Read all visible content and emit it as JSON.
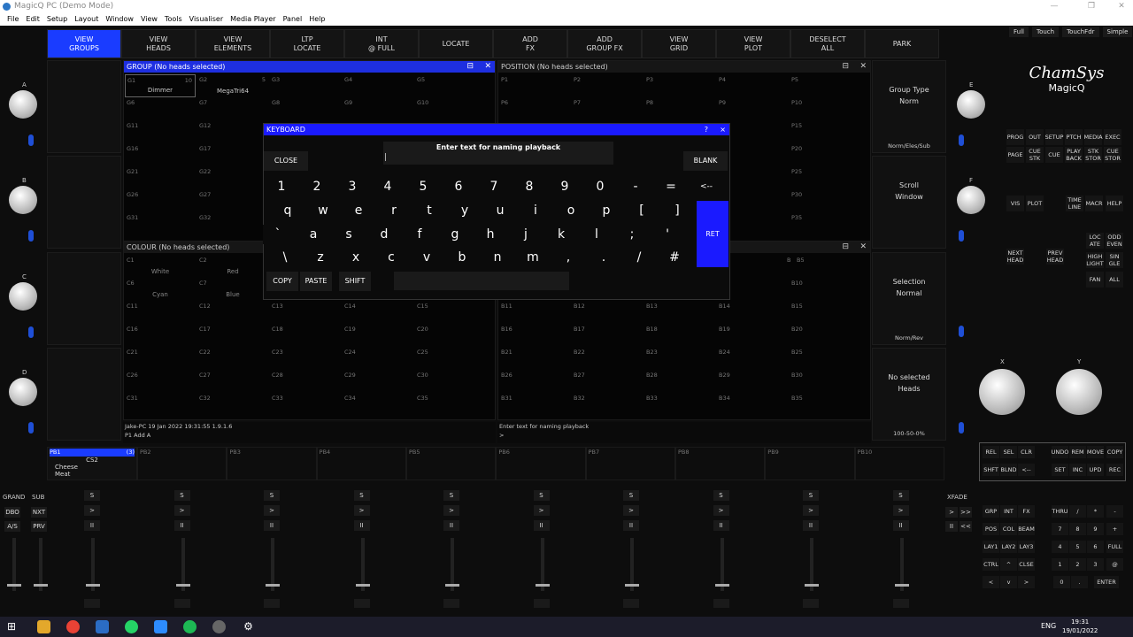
{
  "window": {
    "title": "MagicQ PC (Demo Mode)"
  },
  "menu": [
    "File",
    "Edit",
    "Setup",
    "Layout",
    "Window",
    "View",
    "Tools",
    "Visualiser",
    "Media Player",
    "Panel",
    "Help"
  ],
  "view_buttons": [
    "VIEW\nGROUPS",
    "VIEW\nHEADS",
    "VIEW\nELEMENTS",
    "LTP\nLOCATE",
    "INT\n@ FULL",
    "LOCATE",
    "ADD\nFX",
    "ADD\nGROUP FX",
    "VIEW\nGRID",
    "VIEW\nPLOT",
    "DESELECT\nALL",
    "PARK"
  ],
  "top_right": [
    "Full",
    "Touch",
    "TouchFdr",
    "Simple"
  ],
  "encoders_left": [
    "A",
    "B",
    "C",
    "D"
  ],
  "encoders_right": [
    "E",
    "F"
  ],
  "xy": [
    "X",
    "Y"
  ],
  "group_window": {
    "title": "GROUP (No heads selected)",
    "cells": [
      {
        "id": "G1",
        "num": "10",
        "name": "Dimmer"
      },
      {
        "id": "G2",
        "num": "5",
        "name": "MegaTri64"
      },
      {
        "id": "G3"
      },
      {
        "id": "G4"
      },
      {
        "id": "G5"
      },
      {
        "id": "G6"
      },
      {
        "id": "G7"
      },
      {
        "id": "G8"
      },
      {
        "id": "G9"
      },
      {
        "id": "G10"
      },
      {
        "id": "G11"
      },
      {
        "id": "G12"
      },
      {
        "id": "G16"
      },
      {
        "id": "G17"
      },
      {
        "id": "G21"
      },
      {
        "id": "G22"
      },
      {
        "id": "G26"
      },
      {
        "id": "G27"
      },
      {
        "id": "G31"
      },
      {
        "id": "G32"
      }
    ]
  },
  "position_window": {
    "title": "POSITION (No heads selected)",
    "cells": [
      "P1",
      "P2",
      "P3",
      "P4",
      "P5",
      "P6",
      "P7",
      "P8",
      "P9",
      "P10",
      "P15",
      "P20",
      "P25",
      "P30",
      "P35"
    ]
  },
  "colour_window": {
    "title": "COLOUR (No heads selected)",
    "cells": [
      {
        "id": "C1",
        "name": "White"
      },
      {
        "id": "C2",
        "name": "Red"
      },
      {
        "id": "C6",
        "name": "Cyan"
      },
      {
        "id": "C7",
        "name": "Blue"
      },
      {
        "id": "C11"
      },
      {
        "id": "C12"
      },
      {
        "id": "C13"
      },
      {
        "id": "C14"
      },
      {
        "id": "C15"
      },
      {
        "id": "C16"
      },
      {
        "id": "C17"
      },
      {
        "id": "C18"
      },
      {
        "id": "C19"
      },
      {
        "id": "C20"
      },
      {
        "id": "C21"
      },
      {
        "id": "C22"
      },
      {
        "id": "C23"
      },
      {
        "id": "C24"
      },
      {
        "id": "C25"
      },
      {
        "id": "C26"
      },
      {
        "id": "C27"
      },
      {
        "id": "C28"
      },
      {
        "id": "C29"
      },
      {
        "id": "C30"
      },
      {
        "id": "C31"
      },
      {
        "id": "C32"
      },
      {
        "id": "C33"
      },
      {
        "id": "C34"
      },
      {
        "id": "C35"
      }
    ]
  },
  "beam_window": {
    "cells": [
      "B5",
      "B10",
      "B11",
      "B12",
      "B13",
      "B14",
      "B15",
      "B16",
      "B17",
      "B18",
      "B19",
      "B20",
      "B21",
      "B22",
      "B23",
      "B24",
      "B25",
      "B26",
      "B27",
      "B28",
      "B29",
      "B30",
      "B31",
      "B32",
      "B33",
      "B34",
      "B35"
    ],
    "shut_fast": "Shut fast",
    "b_label": "B"
  },
  "right_column": [
    {
      "title": "Group Type",
      "value": "Norm",
      "foot": "Norm/Eles/Sub"
    },
    {
      "title": "Scroll",
      "value": "Window",
      "foot": ""
    },
    {
      "title": "Selection",
      "value": "Normal",
      "foot": "Norm/Rev"
    },
    {
      "title": "No selected",
      "value": "Heads",
      "foot": "100-50-0%"
    }
  ],
  "status": {
    "left1": "Jake-PC 19 Jan 2022 19:31:55 1.9.1.6",
    "left2": "P1  Add A",
    "right1": "Enter text for naming playback",
    "right2": ">"
  },
  "keyboard": {
    "title": "KEYBOARD",
    "help": "?",
    "close_x": "×",
    "prompt": "Enter text for naming playback",
    "close": "CLOSE",
    "blank": "BLANK",
    "ret": "RET",
    "copy": "COPY",
    "paste": "PASTE",
    "shift": "SHIFT",
    "row1": [
      "1",
      "2",
      "3",
      "4",
      "5",
      "6",
      "7",
      "8",
      "9",
      "0",
      "-",
      "=",
      "<--"
    ],
    "row2": [
      "q",
      "w",
      "e",
      "r",
      "t",
      "y",
      "u",
      "i",
      "o",
      "p",
      "[",
      "]"
    ],
    "row3": [
      "`",
      "a",
      "s",
      "d",
      "f",
      "g",
      "h",
      "j",
      "k",
      "l",
      ";",
      "'"
    ],
    "row4": [
      "\\",
      "z",
      "x",
      "c",
      "v",
      "b",
      "n",
      "m",
      ",",
      ".",
      "/",
      "#"
    ]
  },
  "logo": {
    "brand": "ChamSys",
    "product": "MagicQ"
  },
  "console_keys_right": [
    [
      "PROG",
      "OUT",
      "SETUP",
      "PTCH",
      "MEDIA",
      "EXEC"
    ],
    [
      "PAGE",
      "CUE STK",
      "CUE",
      "PLAY BACK",
      "STK STOR",
      "CUE STOR"
    ]
  ],
  "console_keys_mid": [
    "VIS",
    "PLOT",
    "TIME LINE",
    "MACR",
    "HELP"
  ],
  "console_keys_lower": [
    [
      "LOC ATE",
      "ODD EVEN"
    ],
    [
      "HIGH LIGHT",
      "SIN GLE"
    ],
    [
      "FAN",
      "ALL"
    ]
  ],
  "next_head": "NEXT HEAD",
  "prev_head": "PREV HEAD",
  "edit_keys": [
    [
      "REL",
      "SEL",
      "CLR",
      "UNDO",
      "REM",
      "MOVE",
      "COPY"
    ],
    [
      "SHFT",
      "BLND",
      "<--",
      "SET",
      "INC",
      "UPD",
      "REC"
    ]
  ],
  "playbacks": [
    {
      "id": "PB1",
      "count": "(3)",
      "cue": "CS2",
      "name": "Cheese\nMeat"
    },
    {
      "id": "PB2"
    },
    {
      "id": "PB3"
    },
    {
      "id": "PB4"
    },
    {
      "id": "PB5"
    },
    {
      "id": "PB6"
    },
    {
      "id": "PB7"
    },
    {
      "id": "PB8"
    },
    {
      "id": "PB9"
    },
    {
      "id": "PB10"
    }
  ],
  "grand": "GRAND",
  "sub": "SUB",
  "xfade": "XFADE",
  "left_btns": [
    "DBO",
    "NXT",
    "A/S",
    "PRV"
  ],
  "fader_btns": {
    "s": "S",
    "go": ">",
    "pause": "II"
  },
  "keypad": [
    [
      "GRP",
      "INT",
      "FX",
      "THRU",
      "/",
      "*",
      "-"
    ],
    [
      "POS",
      "COL",
      "BEAM",
      "7",
      "8",
      "9",
      "+"
    ],
    [
      "LAY1",
      "LAY2",
      "LAY3",
      "4",
      "5",
      "6",
      "FULL"
    ],
    [
      "CTRL",
      "^",
      "CLSE",
      "1",
      "2",
      "3",
      "@"
    ],
    [
      "<",
      "v",
      ">",
      "0",
      ".",
      "ENTER"
    ]
  ],
  "xfade_btns": [
    ">",
    ">>",
    "II",
    "<<"
  ],
  "taskbar": {
    "lang": "ENG",
    "time": "19:31",
    "date": "19/01/2022"
  }
}
